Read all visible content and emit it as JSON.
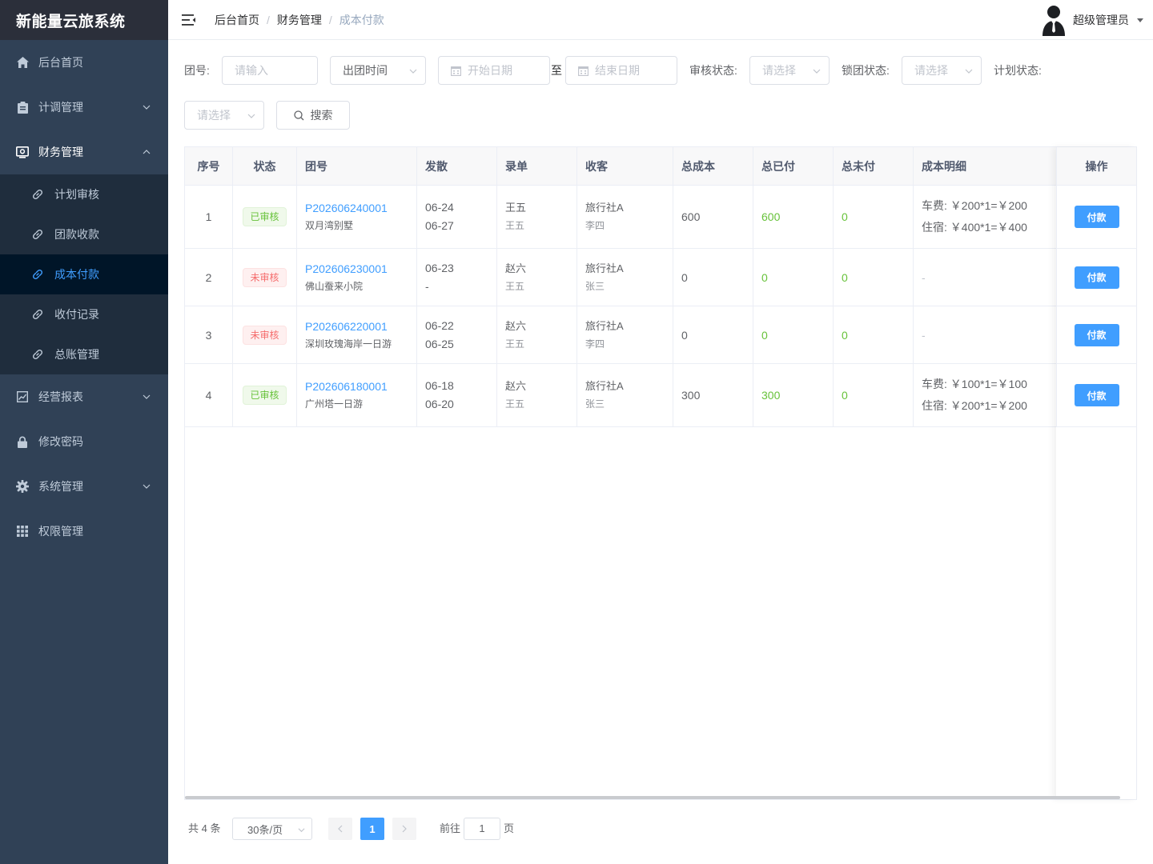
{
  "app": {
    "title": "新能量云旅系统"
  },
  "sidebar": {
    "items": [
      {
        "label": "后台首页",
        "icon": "home-icon"
      },
      {
        "label": "计调管理",
        "icon": "clipboard-icon"
      },
      {
        "label": "财务管理",
        "icon": "finance-icon"
      },
      {
        "label": "经营报表",
        "icon": "chart-icon"
      },
      {
        "label": "修改密码",
        "icon": "lock-icon"
      },
      {
        "label": "系统管理",
        "icon": "gear-icon"
      },
      {
        "label": "权限管理",
        "icon": "grid-icon"
      }
    ],
    "finance_sub": [
      {
        "label": "计划审核"
      },
      {
        "label": "团款收款"
      },
      {
        "label": "成本付款"
      },
      {
        "label": "收付记录"
      },
      {
        "label": "总账管理"
      }
    ]
  },
  "header": {
    "breadcrumb": [
      "后台首页",
      "财务管理",
      "成本付款"
    ],
    "separator": "/",
    "user": "超级管理员"
  },
  "filter": {
    "group_label": "团号:",
    "group_placeholder": "请输入",
    "date_type": "出团时间",
    "start_placeholder": "开始日期",
    "to": "至",
    "end_placeholder": "结束日期",
    "audit_label": "审核状态:",
    "audit_placeholder": "请选择",
    "lock_label": "锁团状态:",
    "lock_placeholder": "请选择",
    "plan_label": "计划状态:",
    "plan_placeholder": "请选择",
    "search": "搜索"
  },
  "table": {
    "columns": [
      "序号",
      "状态",
      "团号",
      "发散",
      "录单",
      "收客",
      "总成本",
      "总已付",
      "总未付",
      "成本明细",
      "操作"
    ],
    "rows": [
      {
        "index": "1",
        "status": "已审核",
        "status_type": "ok",
        "group_no": "P202606240001",
        "group_name": "双月湾别墅",
        "date1": "06-24",
        "date2": "06-27",
        "entry1": "王五",
        "entry2": "王五",
        "client1": "旅行社A",
        "client2": "李四",
        "total_cost": "600",
        "paid": "600",
        "unpaid": "0",
        "detail1": "车费: ￥200*1=￥200",
        "detail2": "住宿: ￥400*1=￥400",
        "action": "付款"
      },
      {
        "index": "2",
        "status": "未审核",
        "status_type": "no",
        "group_no": "P202606230001",
        "group_name": "佛山蚕来小院",
        "date1": "06-23",
        "date2": "-",
        "entry1": "赵六",
        "entry2": "王五",
        "client1": "旅行社A",
        "client2": "张三",
        "total_cost": "0",
        "paid": "0",
        "unpaid": "0",
        "detail1": "-",
        "detail2": "",
        "action": "付款"
      },
      {
        "index": "3",
        "status": "未审核",
        "status_type": "no",
        "group_no": "P202606220001",
        "group_name": "深圳玫瑰海岸一日游",
        "date1": "06-22",
        "date2": "06-25",
        "entry1": "赵六",
        "entry2": "王五",
        "client1": "旅行社A",
        "client2": "李四",
        "total_cost": "0",
        "paid": "0",
        "unpaid": "0",
        "detail1": "-",
        "detail2": "",
        "action": "付款"
      },
      {
        "index": "4",
        "status": "已审核",
        "status_type": "ok",
        "group_no": "P202606180001",
        "group_name": "广州塔一日游",
        "date1": "06-18",
        "date2": "06-20",
        "entry1": "赵六",
        "entry2": "王五",
        "client1": "旅行社A",
        "client2": "张三",
        "total_cost": "300",
        "paid": "300",
        "unpaid": "0",
        "detail1": "车费: ￥100*1=￥100",
        "detail2": "住宿: ￥200*1=￥200",
        "action": "付款"
      }
    ]
  },
  "pagination": {
    "total": "共 4 条",
    "page_size": "30条/页",
    "current": "1",
    "goto_label": "前往",
    "goto_value": "1",
    "page_unit": "页"
  },
  "colors": {
    "sidebar_bg": "#304156",
    "active_sub_bg": "#001528",
    "primary": "#409eff",
    "success": "#67c23a",
    "danger": "#f56c6c"
  }
}
